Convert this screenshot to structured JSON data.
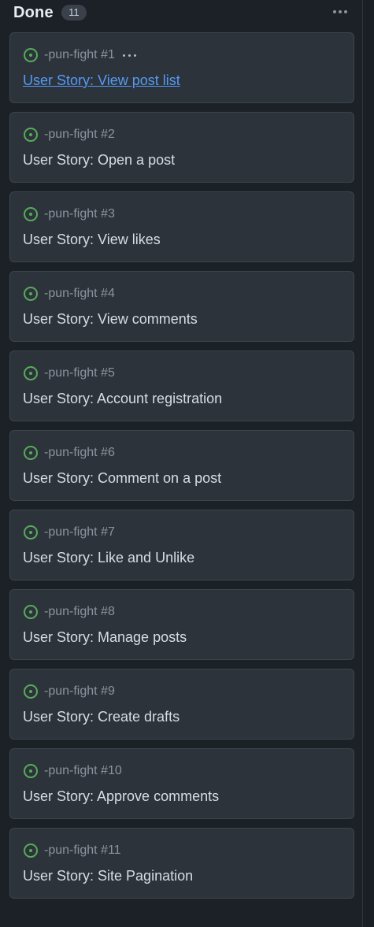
{
  "column": {
    "title": "Done",
    "count": "11"
  },
  "colors": {
    "status_open": "#57ab5a",
    "link": "#539bf5",
    "card_bg": "#2d333b",
    "page_bg": "#1c2128"
  },
  "cards": [
    {
      "repo": "-pun-fight #1",
      "title": "User Story: View post list",
      "link": true,
      "show_menu": true,
      "status_icon": "issue-open-icon"
    },
    {
      "repo": "-pun-fight #2",
      "title": "User Story: Open a post",
      "status_icon": "issue-open-icon"
    },
    {
      "repo": "-pun-fight #3",
      "title": "User Story: View likes",
      "status_icon": "issue-open-icon"
    },
    {
      "repo": "-pun-fight #4",
      "title": "User Story: View comments",
      "status_icon": "issue-open-icon"
    },
    {
      "repo": "-pun-fight #5",
      "title": "User Story: Account registration",
      "status_icon": "issue-open-icon"
    },
    {
      "repo": "-pun-fight #6",
      "title": "User Story: Comment on a post",
      "status_icon": "issue-open-icon"
    },
    {
      "repo": "-pun-fight #7",
      "title": "User Story: Like and Unlike",
      "status_icon": "issue-open-icon"
    },
    {
      "repo": "-pun-fight #8",
      "title": "User Story: Manage posts",
      "status_icon": "issue-open-icon"
    },
    {
      "repo": "-pun-fight #9",
      "title": "User Story: Create drafts",
      "status_icon": "issue-open-icon"
    },
    {
      "repo": "-pun-fight #10",
      "title": "User Story: Approve comments",
      "status_icon": "issue-open-icon"
    },
    {
      "repo": "-pun-fight #11",
      "title": "User Story: Site Pagination",
      "status_icon": "issue-open-icon"
    }
  ]
}
